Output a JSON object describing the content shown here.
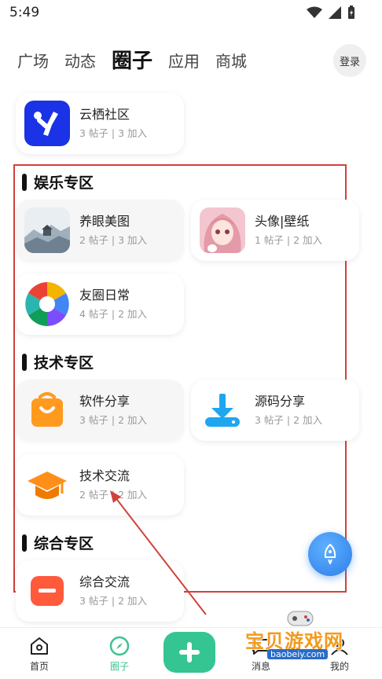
{
  "status": {
    "time": "5:49"
  },
  "tabs": [
    {
      "label": "广场"
    },
    {
      "label": "动态"
    },
    {
      "label": "圈子"
    },
    {
      "label": "应用"
    },
    {
      "label": "商城"
    }
  ],
  "login_label": "登录",
  "top_card": {
    "title": "云栖社区",
    "sub": "3 帖子 | 3 加入"
  },
  "sections": {
    "entertainment": {
      "title": "娱乐专区",
      "cards": [
        {
          "title": "养眼美图",
          "sub": "2 帖子 | 3 加入"
        },
        {
          "title": "头像|壁纸",
          "sub": "1 帖子 | 2 加入"
        },
        {
          "title": "友圈日常",
          "sub": "4 帖子 | 2 加入"
        }
      ]
    },
    "tech": {
      "title": "技术专区",
      "cards": [
        {
          "title": "软件分享",
          "sub": "3 帖子 | 2 加入"
        },
        {
          "title": "源码分享",
          "sub": "3 帖子 | 2 加入"
        },
        {
          "title": "技术交流",
          "sub": "2 帖子 | 2 加入"
        }
      ]
    },
    "general": {
      "title": "综合专区",
      "cards": [
        {
          "title": "综合交流",
          "sub": "3 帖子 | 2 加入"
        }
      ]
    }
  },
  "bottom_nav": {
    "home": "首页",
    "circle": "圈子",
    "messages": "消息",
    "mine": "我的"
  },
  "watermark": {
    "text": "宝贝游戏网",
    "url": "baobeiy.com"
  },
  "colors": {
    "accent": "#35c592",
    "annotation": "#d0433b",
    "rocket": "#2d7fe8"
  }
}
